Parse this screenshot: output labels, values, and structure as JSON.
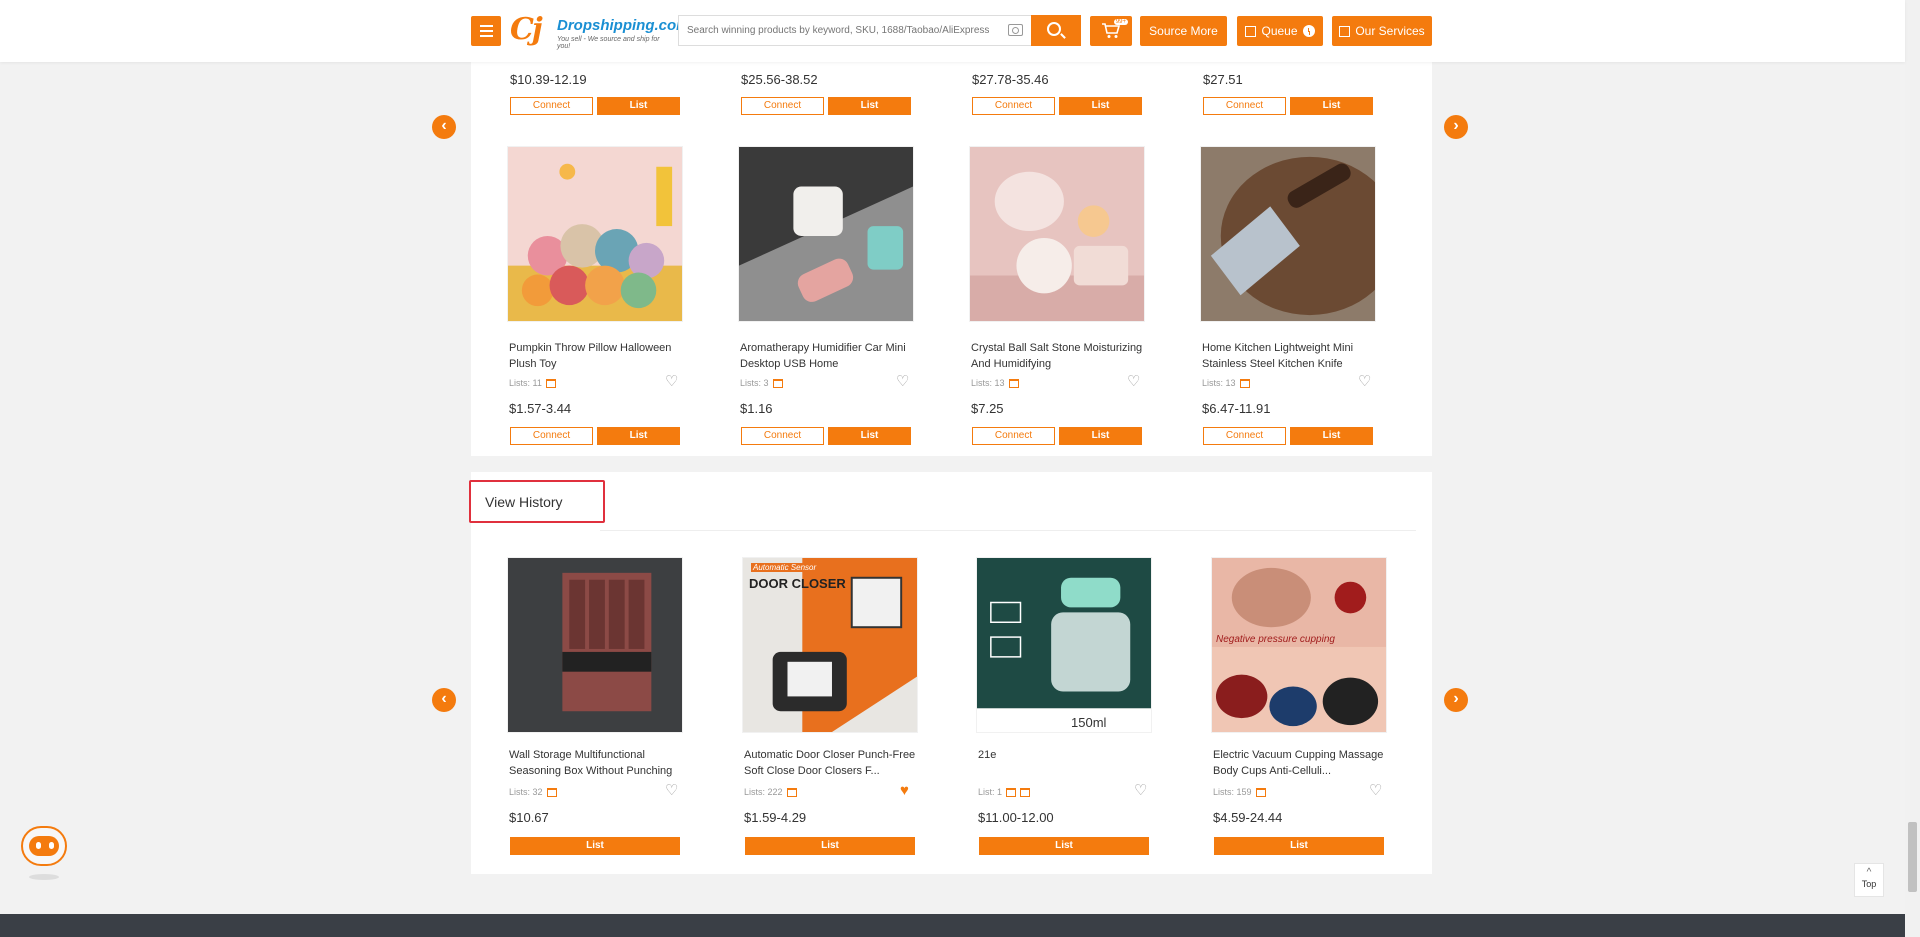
{
  "header": {
    "logo_name": "Dropshipping.com",
    "logo_sub": "You sell - We source and ship for you!",
    "search_placeholder": "Search winning products by keyword, SKU, 1688/Taobao/AliExpress URL",
    "cart_badge": "99+",
    "source_more": "Source More",
    "queue": "Queue",
    "our_services": "Our Services"
  },
  "top_row_prices": [
    {
      "price": "$10.39-12.19"
    },
    {
      "price": "$25.56-38.52"
    },
    {
      "price": "$27.78-35.46"
    },
    {
      "price": "$27.51"
    }
  ],
  "buttons": {
    "connect": "Connect",
    "list": "List"
  },
  "products": [
    {
      "title": "Pumpkin Throw Pillow Halloween Plush Toy",
      "lists": "Lists: 11",
      "price": "$1.57-3.44"
    },
    {
      "title": "Aromatherapy Humidifier Car Mini Desktop USB Home",
      "lists": "Lists: 3",
      "price": "$1.16"
    },
    {
      "title": "Crystal Ball Salt Stone Moisturizing And Humidifying",
      "lists": "Lists: 13",
      "price": "$7.25"
    },
    {
      "title": "Home Kitchen Lightweight Mini Stainless Steel Kitchen Knife",
      "lists": "Lists: 13",
      "price": "$6.47-11.91"
    }
  ],
  "view_history": {
    "title": "View History",
    "items": [
      {
        "title": "Wall Storage Multifunctional Seasoning Box Without Punching",
        "lists": "Lists: 32",
        "price": "$10.67",
        "favorited": false
      },
      {
        "title": "Automatic Door Closer Punch-Free Soft Close Door Closers F...",
        "lists": "Lists: 222",
        "price": "$1.59-4.29",
        "favorited": true,
        "image_text_1": "Automatic Sensor",
        "image_text_2": "DOOR CLOSER"
      },
      {
        "title": "21e",
        "lists": "List: 1",
        "price": "$11.00-12.00",
        "favorited": false,
        "image_caption": "150ml"
      },
      {
        "title": "Electric Vacuum Cupping Massage Body Cups Anti-Celluli...",
        "lists": "Lists: 159",
        "price": "$4.59-24.44",
        "favorited": false,
        "image_text": "Negative pressure cupping"
      }
    ]
  },
  "top_button": "Top",
  "colors": {
    "accent": "#f47b0e",
    "highlight_border": "#e0303d",
    "footer": "#3a3f46"
  },
  "icons": [
    "menu-icon",
    "search-icon",
    "camera-icon",
    "cart-icon",
    "queue-icon",
    "services-icon",
    "chevron-left-icon",
    "chevron-right-icon",
    "heart-icon",
    "store-icon",
    "chevron-up-icon",
    "robot-icon"
  ]
}
